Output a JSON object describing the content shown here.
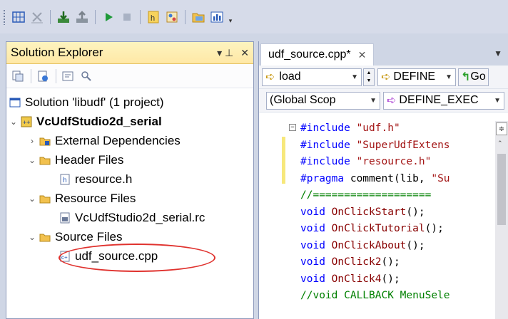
{
  "toolbar": {
    "buttons": [
      "grid-icon",
      "cancel-icon",
      "download-icon",
      "upload-icon",
      "play-icon",
      "stop-icon",
      "h-file-icon",
      "pattern-icon",
      "folder-image-icon",
      "chart-icon"
    ],
    "overflow": "▾"
  },
  "solution_explorer": {
    "title": "Solution Explorer",
    "pin": "▾ ⊥",
    "close": "✕",
    "tree": {
      "solution": "Solution 'libudf' (1 project)",
      "project": "VcUdfStudio2d_serial",
      "external_dependencies": "External Dependencies",
      "header_files": "Header Files",
      "header_file_1": "resource.h",
      "resource_files": "Resource Files",
      "resource_file_1": "VcUdfStudio2d_serial.rc",
      "source_files": "Source Files",
      "source_file_1": "udf_source.cpp"
    }
  },
  "editor": {
    "tab_label": "udf_source.cpp*",
    "tab_close": "✕",
    "nav": {
      "load_combo": "load",
      "define_combo": "DEFINE",
      "go_label": "Go",
      "scope_combo": "(Global Scop",
      "member_combo": "DEFINE_EXEC"
    },
    "code": [
      {
        "parts": [
          [
            "pp",
            "#include "
          ],
          [
            "str",
            "\"udf.h\""
          ]
        ]
      },
      {
        "parts": [
          [
            "pp",
            "#include "
          ],
          [
            "str",
            "\"SuperUdfExtens"
          ]
        ]
      },
      {
        "parts": [
          [
            "pp",
            "#include "
          ],
          [
            "str",
            "\"resource.h\""
          ]
        ]
      },
      {
        "parts": [
          [
            "pp",
            "#pragma "
          ],
          [
            "plain",
            "comment(lib, "
          ],
          [
            "str",
            "\"Su"
          ]
        ]
      },
      {
        "parts": [
          [
            "cm",
            "//==================="
          ]
        ]
      },
      {
        "parts": [
          [
            "kw",
            "void "
          ],
          [
            "fn",
            "OnClickStart"
          ],
          [
            "plain",
            "();"
          ]
        ]
      },
      {
        "parts": [
          [
            "kw",
            "void "
          ],
          [
            "fn",
            "OnClickTutorial"
          ],
          [
            "plain",
            "();"
          ]
        ]
      },
      {
        "parts": [
          [
            "kw",
            "void "
          ],
          [
            "fn",
            "OnClickAbout"
          ],
          [
            "plain",
            "();"
          ]
        ]
      },
      {
        "parts": [
          [
            "kw",
            "void "
          ],
          [
            "fn",
            "OnClick2"
          ],
          [
            "plain",
            "();"
          ]
        ]
      },
      {
        "parts": [
          [
            "kw",
            "void "
          ],
          [
            "fn",
            "OnClick4"
          ],
          [
            "plain",
            "();"
          ]
        ]
      },
      {
        "parts": [
          [
            "cm",
            "//void CALLBACK MenuSele"
          ]
        ]
      }
    ]
  },
  "colors": {
    "panel_title_bg": "#ffe8a6",
    "ide_bg": "#cfd6e5",
    "highlight_ellipse": "#e0322e"
  }
}
